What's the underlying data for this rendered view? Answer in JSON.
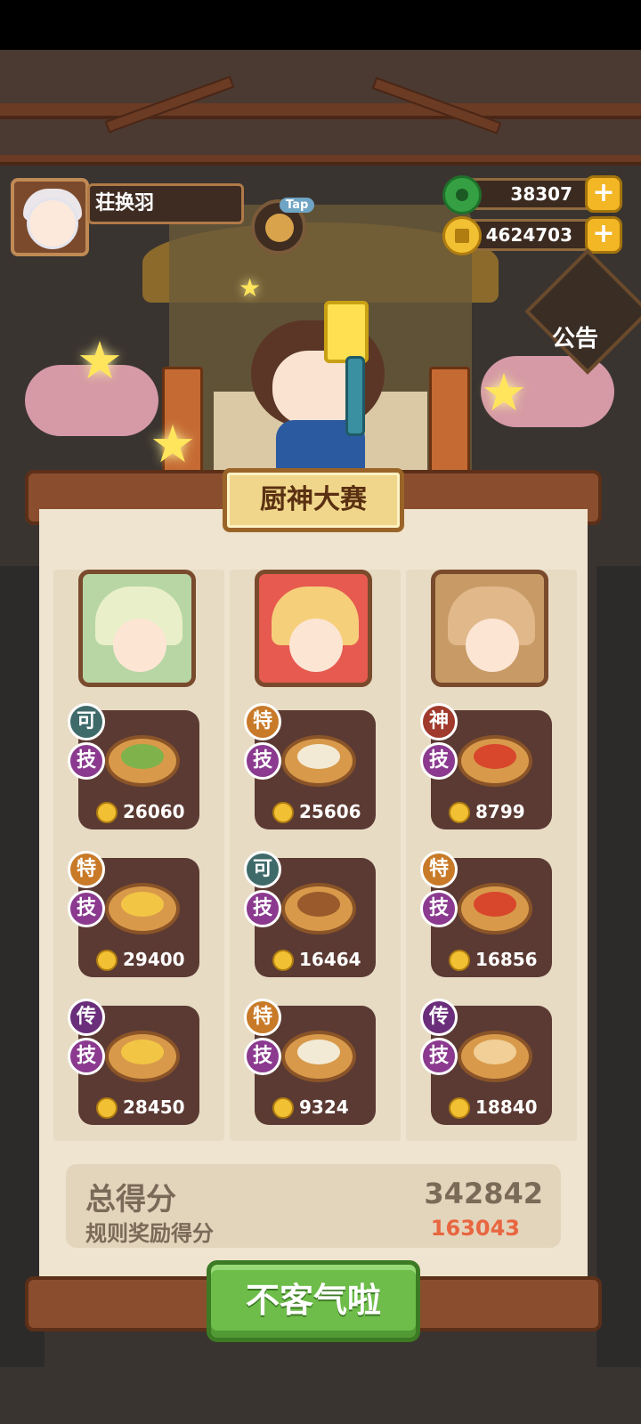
{
  "player": {
    "name": "荘换羽",
    "tap_label": "Tap"
  },
  "currency": {
    "jade": "38307",
    "coins": "4624703",
    "plus_label": "+"
  },
  "notice": {
    "label": "公告"
  },
  "contest": {
    "title": "厨神大赛",
    "chefs": [
      {
        "name": "chef-1",
        "dishes": [
          {
            "grade": "可",
            "skill": "技",
            "score": "26060",
            "dish_icon": "sandwich-dish"
          },
          {
            "grade": "特",
            "skill": "技",
            "score": "29400",
            "dish_icon": "shrimp-basket-dish"
          },
          {
            "grade": "传",
            "skill": "技",
            "score": "28450",
            "dish_icon": "fried-basket-dish"
          }
        ]
      },
      {
        "name": "chef-2",
        "dishes": [
          {
            "grade": "特",
            "skill": "技",
            "score": "25606",
            "dish_icon": "dumpling-dish"
          },
          {
            "grade": "可",
            "skill": "技",
            "score": "16464",
            "dish_icon": "stew-pot-dish"
          },
          {
            "grade": "特",
            "skill": "技",
            "score": "9324",
            "dish_icon": "soup-bowl-dish"
          }
        ]
      },
      {
        "name": "chef-3",
        "dishes": [
          {
            "grade": "神",
            "skill": "技",
            "score": "8799",
            "dish_icon": "feast-tray-dish"
          },
          {
            "grade": "特",
            "skill": "技",
            "score": "16856",
            "dish_icon": "fruit-platter-dish"
          },
          {
            "grade": "传",
            "skill": "技",
            "score": "18840",
            "dish_icon": "cake-dish"
          }
        ]
      }
    ],
    "total_label": "总得分",
    "total_value": "342842",
    "rule_label": "规则奖励得分",
    "rule_value": "163043",
    "confirm_label": "不客气啦"
  },
  "colors": {
    "grade_ke": "#3f6a6a",
    "grade_te": "#c87a28",
    "grade_shen": "#a03a2c",
    "grade_chuan": "#6a2e7a",
    "skill": "#8b3a8f",
    "confirm_button": "#6ebd4a",
    "rule_value": "#e86640"
  }
}
